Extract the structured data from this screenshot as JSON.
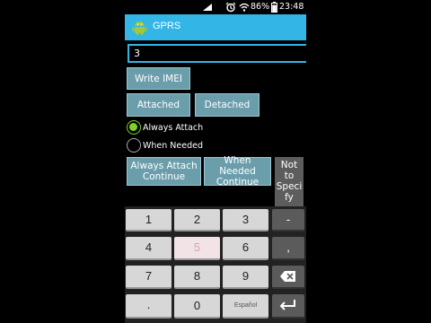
{
  "statusbar": {
    "battery_percent": "86%",
    "time": "23:48",
    "icons": [
      "signal-icon",
      "alarm-icon",
      "wifi-icon",
      "battery-icon"
    ]
  },
  "appbar": {
    "title": "GPRS",
    "accent": "#33b5e5"
  },
  "form": {
    "input_value": "3",
    "write_imei_label": "Write IMEI",
    "attached_label": "Attached",
    "detached_label": "Detached",
    "radio_always_attach": "Always Attach",
    "radio_when_needed": "When Needed",
    "always_attach_continue_l1": "Always Attach",
    "always_attach_continue_l2": "Continue",
    "when_needed_continue_l1": "When Needed",
    "when_needed_continue_l2": "Continue",
    "not_to_specify": [
      "Not",
      "to",
      "Speci",
      "fy"
    ]
  },
  "keyboard": {
    "keys": [
      "1",
      "2",
      "3",
      "-",
      "4",
      "5",
      "6",
      ",",
      "7",
      "8",
      "9",
      "",
      "",
      "0",
      "",
      ""
    ],
    "space_label": "Español",
    "colors": {
      "key": "#d7d7d7",
      "highlight": "#f1e3e6",
      "dark": "#5b5b5b"
    }
  }
}
